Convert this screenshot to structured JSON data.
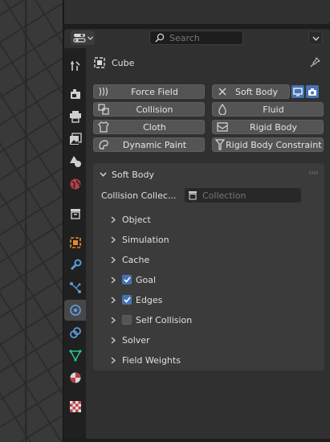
{
  "header": {
    "search_placeholder": "Search"
  },
  "object": {
    "name": "Cube"
  },
  "physics_buttons": [
    {
      "label": "Force Field",
      "icon": "force-field-icon"
    },
    {
      "label": "Soft Body",
      "icon": "close-icon"
    },
    {
      "label": "Collision",
      "icon": "collision-icon"
    },
    {
      "label": "Fluid",
      "icon": "fluid-icon"
    },
    {
      "label": "Cloth",
      "icon": "cloth-icon"
    },
    {
      "label": "Rigid Body",
      "icon": "rigid-body-icon"
    },
    {
      "label": "Dynamic Paint",
      "icon": "dynamic-paint-icon"
    },
    {
      "label": "Rigid Body Constraint",
      "icon": "rigid-body-constraint-icon"
    }
  ],
  "soft_body": {
    "title": "Soft Body",
    "collision_label": "Collision Collec...",
    "collection_placeholder": "Collection",
    "subpanels": [
      {
        "label": "Object",
        "checkbox": null
      },
      {
        "label": "Simulation",
        "checkbox": null
      },
      {
        "label": "Cache",
        "checkbox": null
      },
      {
        "label": "Goal",
        "checkbox": true
      },
      {
        "label": "Edges",
        "checkbox": true
      },
      {
        "label": "Self Collision",
        "checkbox": false
      },
      {
        "label": "Solver",
        "checkbox": null
      },
      {
        "label": "Field Weights",
        "checkbox": null
      }
    ]
  },
  "colors": {
    "accent": "#4772b3",
    "panel_bg": "#3b3b3b",
    "button_bg": "#545454"
  },
  "sidebar_tabs": [
    "tool-icon",
    "render-icon",
    "output-icon",
    "view-layer-icon",
    "scene-icon",
    "world-icon",
    "collection-icon",
    "object-icon",
    "modifier-icon",
    "particles-icon",
    "physics-icon",
    "constraints-icon",
    "data-icon",
    "material-icon",
    "texture-icon"
  ]
}
